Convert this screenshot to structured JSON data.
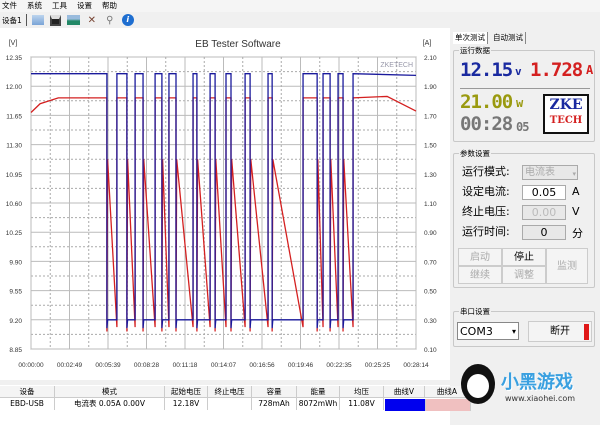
{
  "menu": [
    "文件",
    "系统",
    "工具",
    "设置",
    "帮助"
  ],
  "toolbar": {
    "device_label": "设备1",
    "icons": [
      "open-icon",
      "save-icon",
      "chart-image-icon",
      "tools-icon",
      "zoom-icon",
      "info-icon"
    ]
  },
  "chart_data": {
    "type": "line",
    "title": "EB Tester Software",
    "watermark": "ZKETECH",
    "ylabel_left": "[V]",
    "ylabel_right": "[A]",
    "ylim_left": [
      8.85,
      12.35
    ],
    "ylim_right": [
      0.1,
      2.1
    ],
    "yticks_left": [
      "12.35",
      "12.00",
      "11.65",
      "11.30",
      "10.95",
      "10.60",
      "10.25",
      "9.90",
      "9.55",
      "9.20",
      "8.85"
    ],
    "yticks_right": [
      "2.10",
      "1.90",
      "1.70",
      "1.50",
      "1.30",
      "1.10",
      "0.90",
      "0.70",
      "0.50",
      "0.30",
      "0.10"
    ],
    "xticks": [
      "00:00:00",
      "00:02:49",
      "00:05:39",
      "00:08:28",
      "00:11:18",
      "00:14:07",
      "00:16:56",
      "00:19:46",
      "00:22:35",
      "00:25:25",
      "00:28:14"
    ],
    "xlim_s": [
      0,
      1694
    ],
    "series": [
      {
        "name": "Voltage",
        "axis": "left",
        "color": "#1a1a9c",
        "idle_level": 12.15,
        "load_level": 9.2
      },
      {
        "name": "Current",
        "axis": "right",
        "color": "#d42020",
        "idle_level": 1.82,
        "load_level": 1.4,
        "end_value": 1.73
      }
    ],
    "idle_intervals_s": [
      [
        0,
        334
      ],
      [
        378,
        422
      ],
      [
        458,
        493
      ],
      [
        546,
        576
      ],
      [
        607,
        638
      ],
      [
        713,
        730
      ],
      [
        788,
        810
      ],
      [
        858,
        880
      ],
      [
        942,
        964
      ],
      [
        1043,
        1061
      ],
      [
        1197,
        1259
      ],
      [
        1285,
        1316
      ],
      [
        1351,
        1373
      ],
      [
        1417,
        1694
      ]
    ]
  },
  "panel": {
    "tabs": [
      "单次测试",
      "自动测试"
    ],
    "run_data_title": "运行数据",
    "voltage": "12.15",
    "voltage_unit": "v",
    "current": "1.728",
    "current_unit": "A",
    "power": "21.00",
    "power_unit": "w",
    "time": "00:28",
    "time_sec": "05",
    "logo_top": "ZKE",
    "logo_bottom": "TECH",
    "params_title": "参数设置",
    "mode_label": "运行模式:",
    "mode_value": "电流表",
    "current_set_label": "设定电流:",
    "current_set_value": "0.05",
    "current_set_unit": "A",
    "cutoff_label": "终止电压:",
    "cutoff_value": "0.00",
    "cutoff_unit": "V",
    "runtime_label": "运行时间:",
    "runtime_value": "0",
    "runtime_unit": "分",
    "buttons": {
      "start": "启动",
      "stop": "停止",
      "monitor": "监测",
      "continue": "继续",
      "adjust": "调整"
    },
    "serial_title": "串口设置",
    "port": "COM3",
    "disconnect": "断开",
    "colors": {
      "connected": "#e01818"
    }
  },
  "table": {
    "headers": [
      "设备",
      "模式",
      "起始电压",
      "终止电压",
      "容量",
      "能量",
      "均压",
      "曲线V",
      "曲线A"
    ],
    "rows": [
      [
        "EBD-USB",
        "电流表 0.05A 0.00V",
        "12.18V",
        "",
        "728mAh",
        "8072mWh",
        "11.08V",
        "",
        ""
      ]
    ],
    "swatches": [
      "#0000ee",
      "#f0c0c0"
    ]
  },
  "watermark": {
    "brand": "小黑游戏",
    "url": "www.xiaohei.com"
  }
}
